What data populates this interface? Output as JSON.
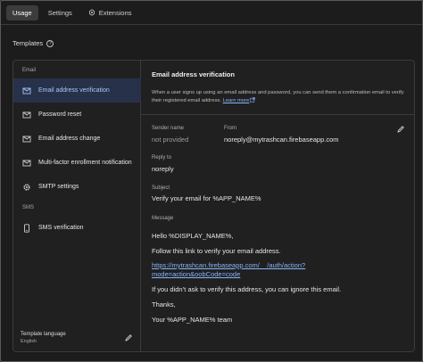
{
  "tabs": [
    {
      "label": "Usage"
    },
    {
      "label": "Settings"
    },
    {
      "label": "Extensions"
    }
  ],
  "section": {
    "title": "Templates"
  },
  "sidebar": {
    "email_group": "Email",
    "sms_group": "SMS",
    "items": [
      {
        "label": "Email address verification"
      },
      {
        "label": "Password reset"
      },
      {
        "label": "Email address change"
      },
      {
        "label": "Multi-factor enrollment notification"
      },
      {
        "label": "SMTP settings"
      },
      {
        "label": "SMS verification"
      }
    ],
    "template_language_label": "Template language",
    "template_language_value": "English"
  },
  "detail": {
    "title": "Email address verification",
    "description": "When a user signs up using an email address and password, you can send them a confirmation email to verify their registered email address.",
    "learn_more": "Learn more",
    "sender_name_label": "Sender name",
    "sender_name_value": "not provided",
    "from_label": "From",
    "from_value": "noreply@mytrashcan.firebaseapp.com",
    "reply_to_label": "Reply to",
    "reply_to_value": "noreply",
    "subject_label": "Subject",
    "subject_value": "Verify your email for %APP_NAME%",
    "message_label": "Message",
    "message_lines": {
      "greeting": "Hello %DISPLAY_NAME%,",
      "instruction": "Follow this link to verify your email address.",
      "link_line1": "https://mytrashcan.firebaseapp.com/__/auth/action?",
      "link_line2": "mode=action&oobCode=code",
      "ignore": "If you didn’t ask to verify this address, you can ignore this email.",
      "thanks": "Thanks,",
      "signature": "Your %APP_NAME% team"
    }
  },
  "colors": {
    "accent": "#8ab4f8",
    "active_bg": "#27324a",
    "background": "#1c1c1c"
  }
}
